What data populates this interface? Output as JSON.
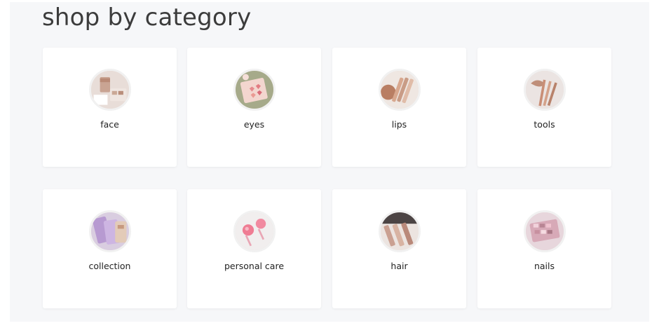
{
  "heading": "shop by category",
  "categories": [
    {
      "label": "face",
      "icon": "face-category-thumbnail"
    },
    {
      "label": "eyes",
      "icon": "eyes-category-thumbnail"
    },
    {
      "label": "lips",
      "icon": "lips-category-thumbnail"
    },
    {
      "label": "tools",
      "icon": "tools-category-thumbnail"
    },
    {
      "label": "collection",
      "icon": "collection-category-thumbnail"
    },
    {
      "label": "personal care",
      "icon": "personal-care-category-thumbnail"
    },
    {
      "label": "hair",
      "icon": "hair-category-thumbnail"
    },
    {
      "label": "nails",
      "icon": "nails-category-thumbnail"
    }
  ]
}
